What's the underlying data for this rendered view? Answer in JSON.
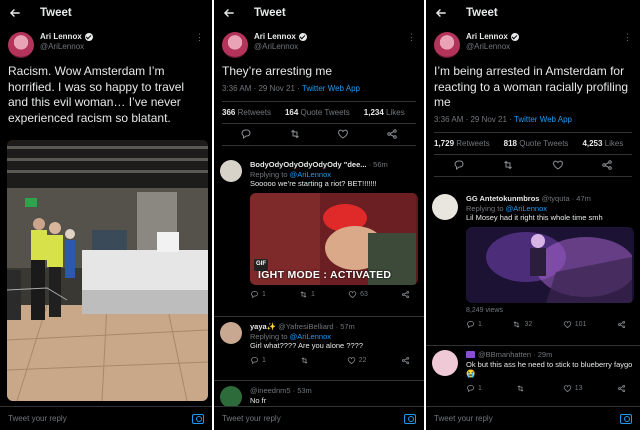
{
  "panel1": {
    "header_title": "Tweet",
    "author_name": "Ari Lennox",
    "author_handle": "@AriLennox",
    "tweet_text": "Racism. Wow Amsterdam I’m horrified. I was so happy to travel and this evil woman… I’ve never experienced racism so blatant.",
    "reply_placeholder": "Tweet your reply"
  },
  "panel2": {
    "header_title": "Tweet",
    "author_name": "Ari Lennox",
    "author_handle": "@AriLennox",
    "tweet_text": "They’re arresting me",
    "time": "3:36 AM · 29 Nov 21 · ",
    "source": "Twitter Web App",
    "retweets": "366",
    "retweets_label": "Retweets",
    "quotes": "164",
    "quotes_label": "Quote Tweets",
    "likes": "1,234",
    "likes_label": "Likes",
    "replies": [
      {
        "name": "BodyOdyOdyOdyOdyOdy \"dee...",
        "time": "· 56m",
        "replying_to_prefix": "Replying to ",
        "replying_to": "@AriLennox",
        "text": "Sooooo we’re starting a riot? BET!!!!!!!",
        "gif_badge": "GIF",
        "media_caption": "IGHT MODE : ACTIVATED",
        "reply_count": "1",
        "retweet_count": "1",
        "like_count": "63"
      },
      {
        "name": "yaya✨",
        "handle": "@YafresiBelliard · 57m",
        "replying_to_prefix": "Replying to ",
        "replying_to": "@AriLennox",
        "text": "Girl what???? Are you alone ????",
        "reply_count": "1",
        "retweet_count": "",
        "like_count": "22"
      },
      {
        "name": "",
        "handle": "@ineednm5 · 53m",
        "text": "No fr"
      }
    ],
    "reply_placeholder": "Tweet your reply"
  },
  "panel3": {
    "header_title": "Tweet",
    "author_name": "Ari Lennox",
    "author_handle": "@AriLennox",
    "tweet_text": "I’m being arrested in Amsterdam for reacting to a woman racially profiling me",
    "time": "3:36 AM · 29 Nov 21 · ",
    "source": "Twitter Web App",
    "retweets": "1,729",
    "retweets_label": "Retweets",
    "quotes": "818",
    "quotes_label": "Quote Tweets",
    "likes": "4,253",
    "likes_label": "Likes",
    "replies": [
      {
        "name": "GG Antetokunmbros",
        "handle": "@tyquta · 47m",
        "replying_to_prefix": "Replying to ",
        "replying_to": "@AriLennox",
        "text": "Lil Mosey had it right this whole time smh",
        "views": "8,249 views",
        "reply_count": "1",
        "retweet_count": "32",
        "like_count": "101"
      },
      {
        "name": "",
        "handle": "@BBmanhatten · 29m",
        "text": "Ok but this ass he need to stick to blueberry faygo 😭",
        "reply_count": "1",
        "retweet_count": "",
        "like_count": "13"
      }
    ],
    "reply_placeholder": "Tweet your reply"
  },
  "colors": {
    "background": "#000000",
    "text": "#e7e9ea",
    "muted": "#71767b",
    "accent": "#1d9bf0",
    "divider": "#2f3336"
  }
}
